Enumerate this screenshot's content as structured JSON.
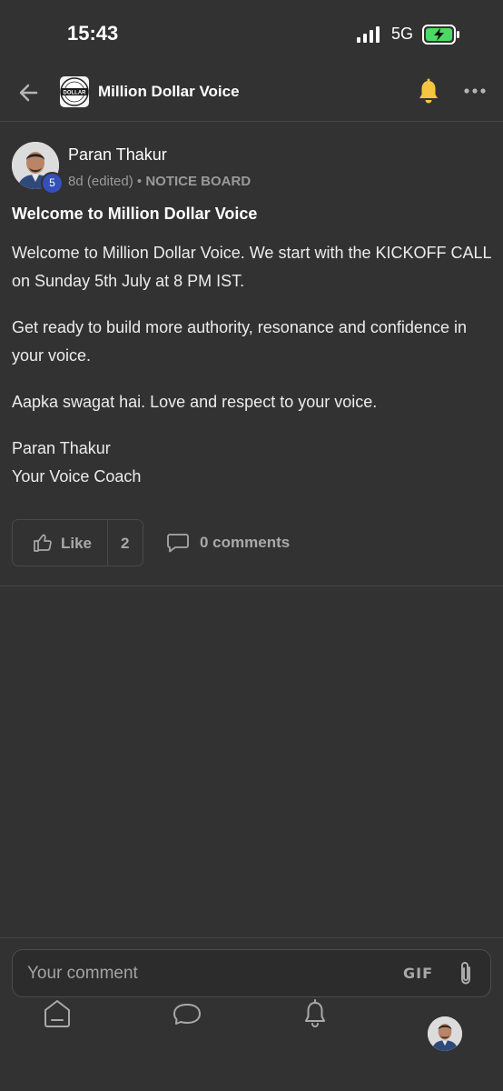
{
  "status_bar": {
    "time": "15:43",
    "network": "5G"
  },
  "header": {
    "community_name": "Million Dollar Voice",
    "logo_text": "DOLLAR"
  },
  "post": {
    "author": "Paran Thakur",
    "level": "5",
    "meta": "8d (edited) •",
    "category": "NOTICE BOARD",
    "title": "Welcome to Million Dollar Voice",
    "paragraphs": [
      "Welcome to Million Dollar Voice. We start with the KICKOFF CALL on Sunday 5th July at 8 PM IST.",
      "Get ready to build more authority, resonance and confidence in your voice.",
      "Aapka swagat hai. Love and respect to your voice.",
      "Paran Thakur"
    ],
    "signature_line": "Your Voice Coach",
    "actions": {
      "like_label": "Like",
      "like_count": "2",
      "comments_label": "0 comments"
    }
  },
  "composer": {
    "placeholder": "Your comment",
    "gif_label": "GIF"
  },
  "icons": {
    "back": "back-arrow-icon",
    "bell": "bell-icon",
    "more": "more-icon",
    "like": "thumbs-up-icon",
    "comment": "comment-icon",
    "attach": "paperclip-icon",
    "home": "home-icon",
    "chat": "chat-icon",
    "notifications": "bell-icon"
  },
  "colors": {
    "background": "#323232",
    "bell_accent": "#f5c542",
    "badge": "#3550b8",
    "battery_fill": "#4cd964"
  }
}
